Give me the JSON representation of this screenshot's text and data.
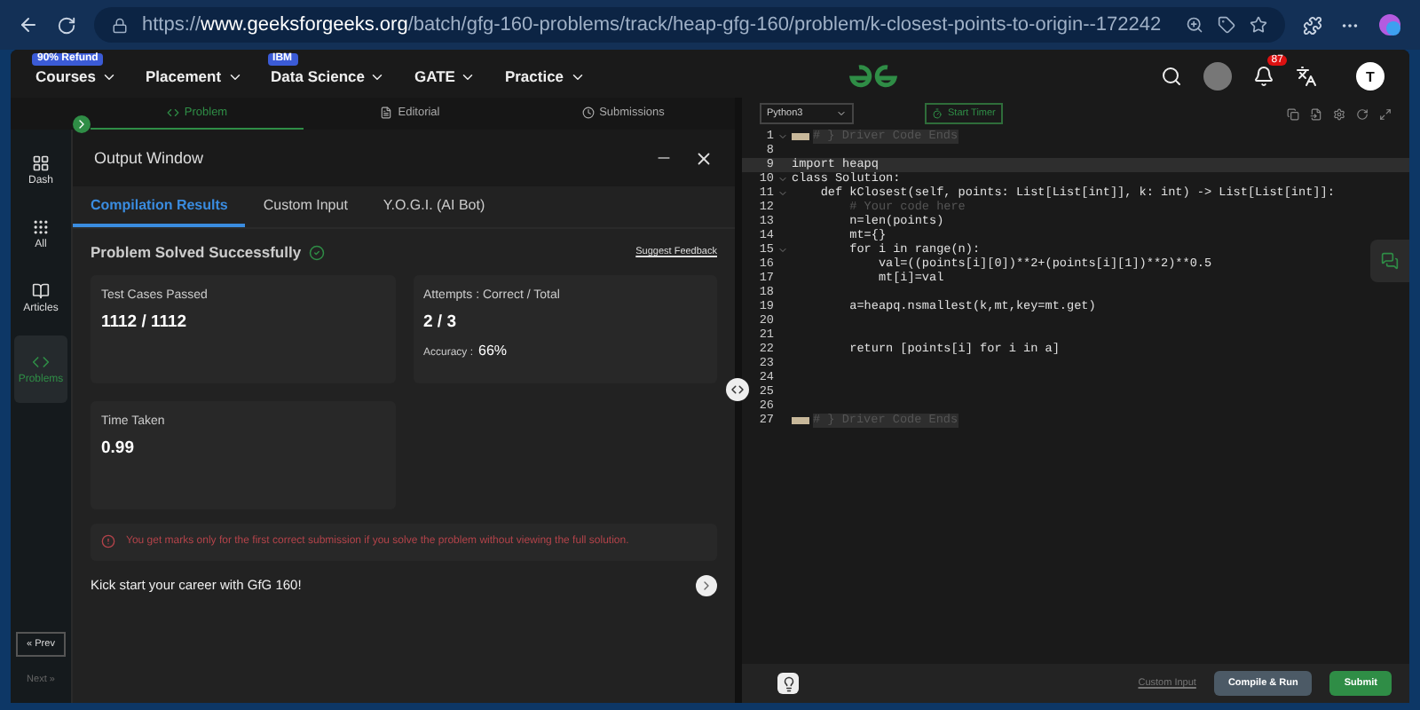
{
  "browser": {
    "url": "https://**www.geeksforgeeks.org**/batch/gfg-160-problems/track/heap-gfg-160/problem/k-closest-points-to-origin--172242"
  },
  "header": {
    "nav": [
      {
        "label": "Courses",
        "badge": "90% Refund"
      },
      {
        "label": "Placement"
      },
      {
        "label": "Data Science",
        "badge": "IBM"
      },
      {
        "label": "GATE"
      },
      {
        "label": "Practice"
      }
    ],
    "notifications": "87",
    "avatar": "T"
  },
  "sidebar": {
    "items": [
      {
        "label": "Dash",
        "selected": false
      },
      {
        "label": "All",
        "selected": false
      },
      {
        "label": "Articles",
        "selected": false
      },
      {
        "label": "Problems",
        "selected": true
      }
    ],
    "prev": {
      "label": "« Prev",
      "disabled": false
    },
    "next": {
      "label": "Next »",
      "disabled": true
    }
  },
  "problem_tabs": [
    {
      "label": "Problem",
      "selected": true
    },
    {
      "label": "Editorial",
      "selected": false
    },
    {
      "label": "Submissions",
      "selected": false
    }
  ],
  "output_window": {
    "title": "Output Window",
    "tabs": [
      {
        "label": "Compilation Results",
        "selected": true
      },
      {
        "label": "Custom Input",
        "selected": false
      },
      {
        "label": "Y.O.G.I. (AI Bot)",
        "selected": false
      }
    ],
    "status": "Problem Solved Successfully",
    "feedback": "Suggest Feedback",
    "cards": [
      {
        "label": "Test Cases Passed",
        "value": "1112 / 1112"
      },
      {
        "label": "Attempts : Correct / Total",
        "value": "2 / 3",
        "sub_label": "Accuracy :",
        "sub_value": "66%"
      },
      {
        "label": "Time Taken",
        "value": "0.99"
      }
    ],
    "notice": "You get marks only for the first correct submission if you solve the problem without viewing the full solution.",
    "promo": "Kick start your career with GfG 160!"
  },
  "editor": {
    "language": "Python3",
    "timer": "Start Timer",
    "lines": [
      {
        "num": "1",
        "kind": "driver",
        "text": "# } Driver Code Ends",
        "foldable": true,
        "active": false
      },
      {
        "num": "8",
        "kind": "code",
        "foldable": false,
        "active": false
      },
      {
        "num": "9",
        "kind": "code",
        "text": "import heapq",
        "foldable": false,
        "active": true
      },
      {
        "num": "10",
        "kind": "code",
        "text": "class Solution:",
        "foldable": true,
        "active": false
      },
      {
        "num": "11",
        "kind": "code",
        "text": "    def kClosest(self, points: List[List[int]], k: int) -> List[List[int]]:",
        "foldable": true,
        "active": false
      },
      {
        "num": "12",
        "kind": "comment",
        "text": "        # Your code here",
        "foldable": false,
        "active": false
      },
      {
        "num": "13",
        "kind": "code",
        "text": "        n=len(points)",
        "foldable": false,
        "active": false
      },
      {
        "num": "14",
        "kind": "code",
        "text": "        mt={}",
        "foldable": false,
        "active": false
      },
      {
        "num": "15",
        "kind": "code",
        "text": "        for i in range(n):",
        "foldable": true,
        "active": false
      },
      {
        "num": "16",
        "kind": "code",
        "text": "            val=((points[i][0])**2+(points[i][1])**2)**0.5",
        "foldable": false,
        "active": false
      },
      {
        "num": "17",
        "kind": "code",
        "text": "            mt[i]=val",
        "foldable": false,
        "active": false
      },
      {
        "num": "18",
        "kind": "code",
        "foldable": false,
        "active": false
      },
      {
        "num": "19",
        "kind": "code",
        "text": "        a=heapq.nsmallest(k,mt,key=mt.get)",
        "foldable": false,
        "active": false
      },
      {
        "num": "20",
        "kind": "code",
        "foldable": false,
        "active": false
      },
      {
        "num": "21",
        "kind": "code",
        "foldable": false,
        "active": false
      },
      {
        "num": "22",
        "kind": "code",
        "text": "        return [points[i] for i in a]",
        "foldable": false,
        "active": false
      },
      {
        "num": "23",
        "kind": "code",
        "foldable": false,
        "active": false
      },
      {
        "num": "24",
        "kind": "code",
        "foldable": false,
        "active": false
      },
      {
        "num": "25",
        "kind": "code",
        "foldable": false,
        "active": false
      },
      {
        "num": "26",
        "kind": "code",
        "foldable": false,
        "active": false
      },
      {
        "num": "27",
        "kind": "driver",
        "text": "# } Driver Code Ends",
        "foldable": false,
        "active": false
      }
    ],
    "custom_input": "Custom Input",
    "compile": "Compile & Run",
    "submit": "Submit"
  }
}
